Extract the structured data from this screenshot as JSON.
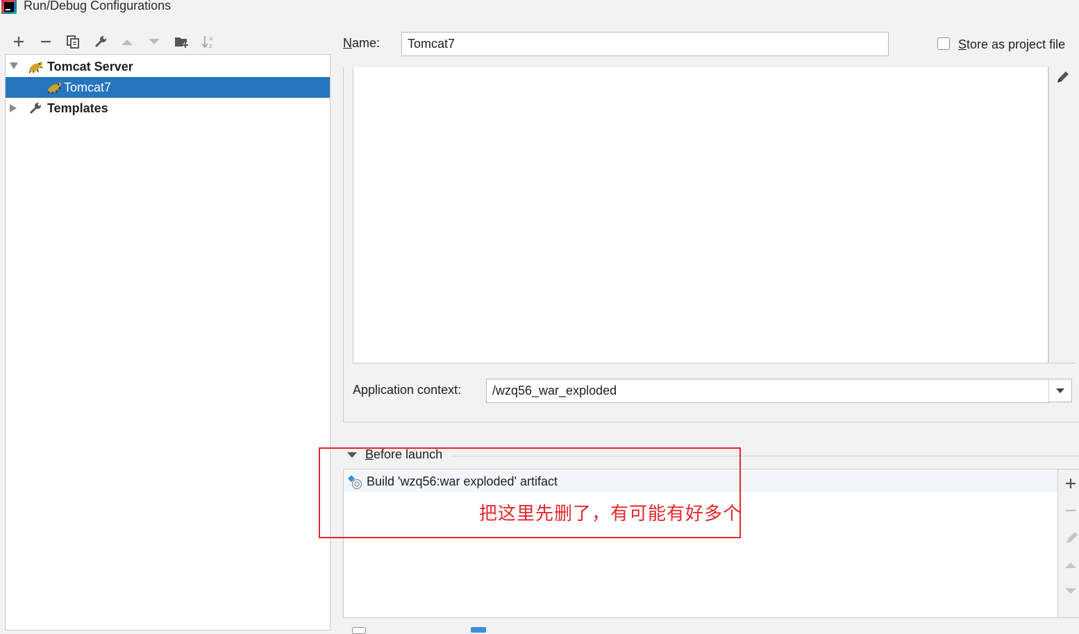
{
  "window": {
    "title": "Run/Debug Configurations"
  },
  "toolbar": {
    "buttons": [
      "add",
      "remove",
      "copy",
      "edit-templates",
      "move-up",
      "move-down",
      "new-folder",
      "sort"
    ]
  },
  "tree": {
    "group": {
      "label": "Tomcat Server",
      "expanded": true
    },
    "selected_item": {
      "label": "Tomcat7"
    },
    "templates": {
      "label": "Templates",
      "expanded": false
    }
  },
  "config": {
    "name_label": "Name:",
    "name_value": "Tomcat7",
    "store_label": "Store as project file",
    "store_checked": false,
    "app_context_label": "Application context:",
    "app_context_value": "/wzq56_war_exploded"
  },
  "before_launch": {
    "label": "Before launch",
    "tasks": [
      "Build 'wzq56:war exploded' artifact"
    ]
  },
  "annotation": {
    "text": "把这里先删了，有可能有好多个",
    "color": "#e4262b"
  },
  "colors": {
    "selection": "#2675bf",
    "panel_bg": "#f2f2f2"
  }
}
